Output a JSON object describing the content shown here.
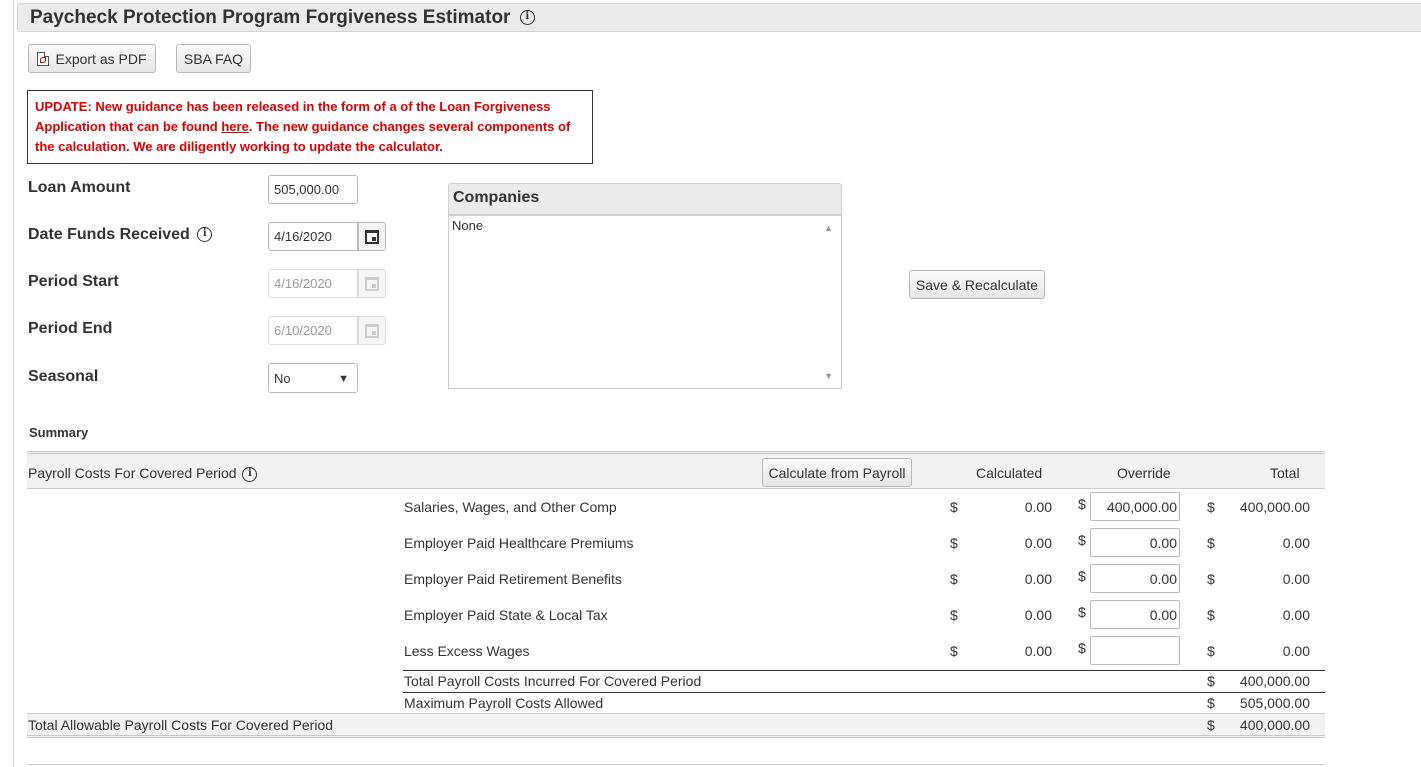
{
  "page": {
    "title": "Paycheck Protection Program Forgiveness Estimator",
    "info_glyph": "i"
  },
  "toolbar": {
    "export_label": "Export as PDF",
    "faq_label": "SBA FAQ",
    "export_icon": "pdf-file-icon"
  },
  "update_notice": {
    "text_before": "UPDATE: New guidance has been released in the form of a of the Loan Forgiveness Application that can be found ",
    "link_text": "here",
    "text_after": ". The new guidance changes several components of the calculation. We are diligently working to update the calculator.",
    "color": "#e00000"
  },
  "form": {
    "loan_amount": {
      "label": "Loan Amount",
      "value": "505,000.00"
    },
    "date_funds_received": {
      "label": "Date Funds Received",
      "value": "4/16/2020"
    },
    "period_start": {
      "label": "Period Start",
      "value": "4/16/2020"
    },
    "period_end": {
      "label": "Period End",
      "value": "6/10/2020"
    },
    "seasonal": {
      "label": "Seasonal",
      "value": "No",
      "arrow": "▼"
    },
    "save_label": "Save & Recalculate"
  },
  "companies": {
    "header": "Companies",
    "items": [
      "None"
    ]
  },
  "summary": {
    "label": "Summary",
    "section_title": "Payroll Costs For Covered Period",
    "calculate_button": "Calculate from Payroll",
    "columns": {
      "calculated": "Calculated",
      "override": "Override",
      "total": "Total"
    },
    "currency": "$",
    "rows": [
      {
        "label": "Salaries, Wages, and Other Comp",
        "calculated": "0.00",
        "override": "400,000.00",
        "total": "400,000.00"
      },
      {
        "label": "Employer Paid Healthcare Premiums",
        "calculated": "0.00",
        "override": "0.00",
        "total": "0.00"
      },
      {
        "label": "Employer Paid Retirement Benefits",
        "calculated": "0.00",
        "override": "0.00",
        "total": "0.00"
      },
      {
        "label": "Employer Paid State & Local Tax",
        "calculated": "0.00",
        "override": "0.00",
        "total": "0.00"
      },
      {
        "label": "Less Excess Wages",
        "calculated": "0.00",
        "override": "",
        "total": "0.00"
      }
    ],
    "total_incurred": {
      "label": "Total Payroll Costs Incurred For Covered Period",
      "value": "400,000.00"
    },
    "maximum_allowed": {
      "label": "Maximum Payroll Costs Allowed",
      "value": "505,000.00"
    },
    "total_allowable": {
      "label": "Total Allowable Payroll Costs For Covered Period",
      "value": "400,000.00"
    }
  }
}
